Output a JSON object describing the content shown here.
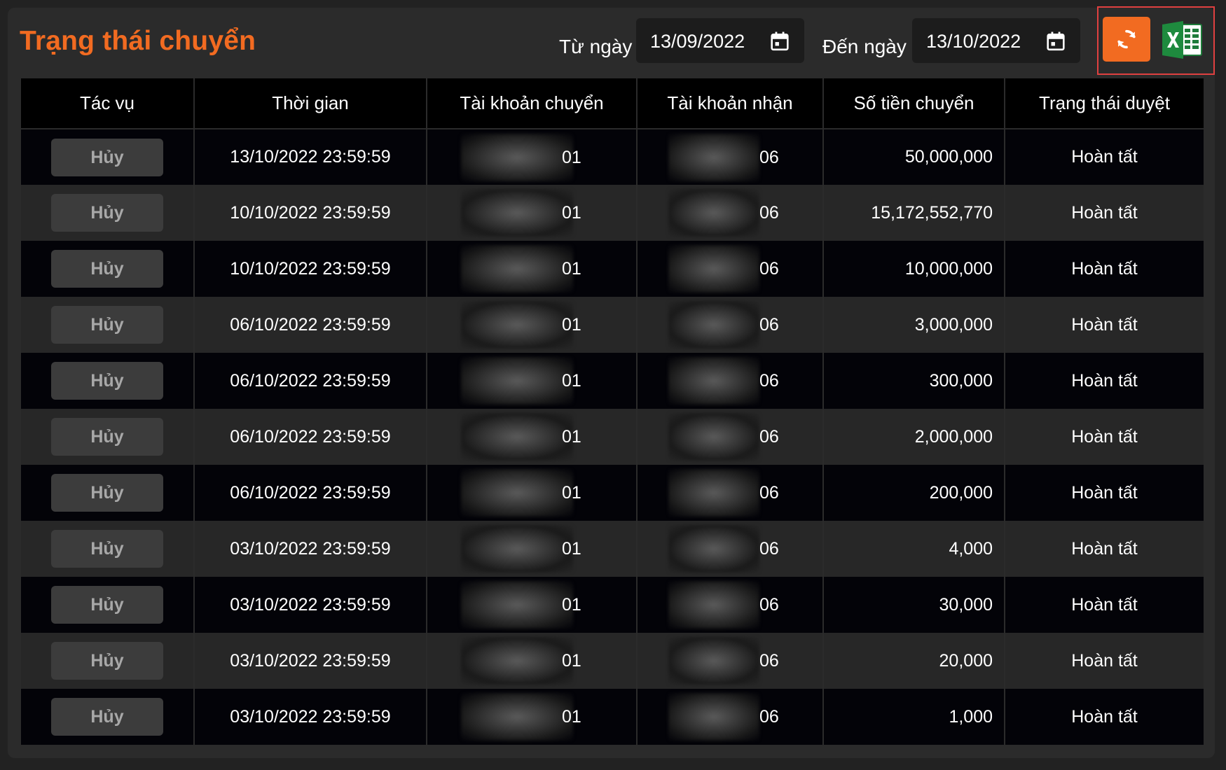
{
  "header": {
    "title": "Trạng thái chuyển",
    "from_label": "Từ ngày",
    "from_value": "13/09/2022",
    "to_label": "Đến ngày",
    "to_value": "13/10/2022",
    "refresh_icon": "refresh-icon",
    "export_icon": "excel-icon"
  },
  "colors": {
    "accent": "#f26b21",
    "status_done": "#2f8f35",
    "highlight_border": "#e04040"
  },
  "table": {
    "columns": [
      "Tác vụ",
      "Thời gian",
      "Tài khoản chuyển",
      "Tài khoản nhận",
      "Số tiền chuyển",
      "Trạng thái duyệt"
    ],
    "rows": [
      {
        "action": "Hủy",
        "time": "13/10/2022 23:59:59",
        "from_acc": "01",
        "to_acc": "06",
        "amount": "50,000,000",
        "status": "Hoàn tất"
      },
      {
        "action": "Hủy",
        "time": "10/10/2022 23:59:59",
        "from_acc": "01",
        "to_acc": "06",
        "amount": "15,172,552,770",
        "status": "Hoàn tất"
      },
      {
        "action": "Hủy",
        "time": "10/10/2022 23:59:59",
        "from_acc": "01",
        "to_acc": "06",
        "amount": "10,000,000",
        "status": "Hoàn tất"
      },
      {
        "action": "Hủy",
        "time": "06/10/2022 23:59:59",
        "from_acc": "01",
        "to_acc": "06",
        "amount": "3,000,000",
        "status": "Hoàn tất"
      },
      {
        "action": "Hủy",
        "time": "06/10/2022 23:59:59",
        "from_acc": "01",
        "to_acc": "06",
        "amount": "300,000",
        "status": "Hoàn tất"
      },
      {
        "action": "Hủy",
        "time": "06/10/2022 23:59:59",
        "from_acc": "01",
        "to_acc": "06",
        "amount": "2,000,000",
        "status": "Hoàn tất"
      },
      {
        "action": "Hủy",
        "time": "06/10/2022 23:59:59",
        "from_acc": "01",
        "to_acc": "06",
        "amount": "200,000",
        "status": "Hoàn tất"
      },
      {
        "action": "Hủy",
        "time": "03/10/2022 23:59:59",
        "from_acc": "01",
        "to_acc": "06",
        "amount": "4,000",
        "status": "Hoàn tất"
      },
      {
        "action": "Hủy",
        "time": "03/10/2022 23:59:59",
        "from_acc": "01",
        "to_acc": "06",
        "amount": "30,000",
        "status": "Hoàn tất"
      },
      {
        "action": "Hủy",
        "time": "03/10/2022 23:59:59",
        "from_acc": "01",
        "to_acc": "06",
        "amount": "20,000",
        "status": "Hoàn tất"
      },
      {
        "action": "Hủy",
        "time": "03/10/2022 23:59:59",
        "from_acc": "01",
        "to_acc": "06",
        "amount": "1,000",
        "status": "Hoàn tất"
      }
    ]
  }
}
